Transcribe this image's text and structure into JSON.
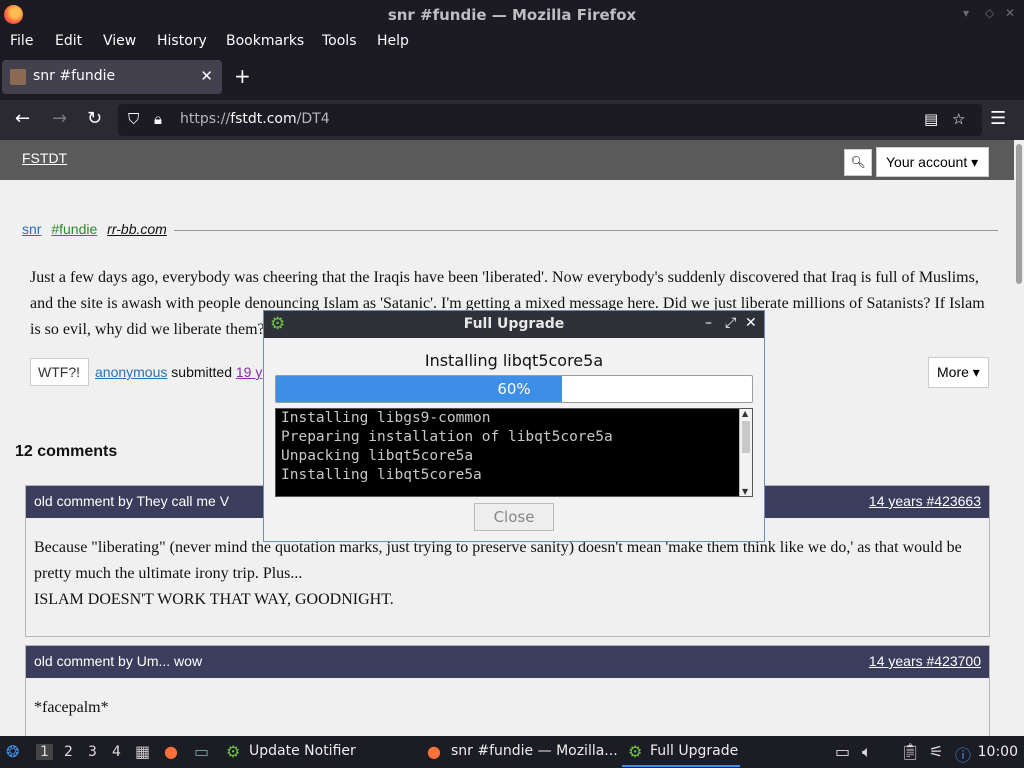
{
  "window": {
    "title": "snr #fundie — Mozilla Firefox"
  },
  "menu": [
    "File",
    "Edit",
    "View",
    "History",
    "Bookmarks",
    "Tools",
    "Help"
  ],
  "tab": {
    "label": "snr #fundie"
  },
  "url": {
    "prefix": "https://",
    "host": "fstdt.com",
    "path": "/DT4"
  },
  "site": {
    "logo": "FSTDT",
    "account_label": "Your account ▾",
    "search_icon": "search-icon"
  },
  "post": {
    "author": "snr",
    "tag": "#fundie",
    "source": "rr-bb.com",
    "text": "Just a few days ago, everybody was cheering that the Iraqis have been 'liberated'. Now everybody's suddenly discovered that Iraq is full of Muslims, and the site is awash with people denouncing Islam as 'Satanic'. I'm getting a mixed message here. Did we just liberate millions of Satanists? If Islam is so evil, why did we liberate them?",
    "wtf_label": "WTF?!",
    "submitter": "anonymous",
    "submitted_text": "submitted",
    "age": "19 y",
    "more_label": "More ▾"
  },
  "comments_count": "12 comments",
  "comments": [
    {
      "header": "old comment by They call me V",
      "meta": "14 years #423663",
      "body": "Because \"liberating\" (never mind the quotation marks, just trying to preserve sanity) doesn't mean 'make them think like we do,' as that would be pretty much the ultimate irony trip. Plus...",
      "body2": "ISLAM DOESN'T WORK THAT WAY, GOODNIGHT."
    },
    {
      "header": "old comment by Um... wow",
      "meta": "14 years #423700",
      "body": "*facepalm*"
    }
  ],
  "dialog": {
    "title": "Full Upgrade",
    "status": "Installing libqt5core5a",
    "progress": 60,
    "progress_label": "60%",
    "log": [
      "Installing libgs9-common",
      "Preparing installation of libqt5core5a",
      "Unpacking libqt5core5a",
      "Installing libqt5core5a"
    ],
    "close_label": "Close"
  },
  "taskbar": {
    "workspaces": [
      "1",
      "2",
      "3",
      "4"
    ],
    "tasks": [
      "Update Notifier",
      "snr #fundie — Mozilla...",
      "Full Upgrade"
    ],
    "clock": "10:00"
  },
  "colors": {
    "accent": "#3d8ee6",
    "comment_header": "#3b3d5c",
    "site_header": "#5a5a5a"
  }
}
